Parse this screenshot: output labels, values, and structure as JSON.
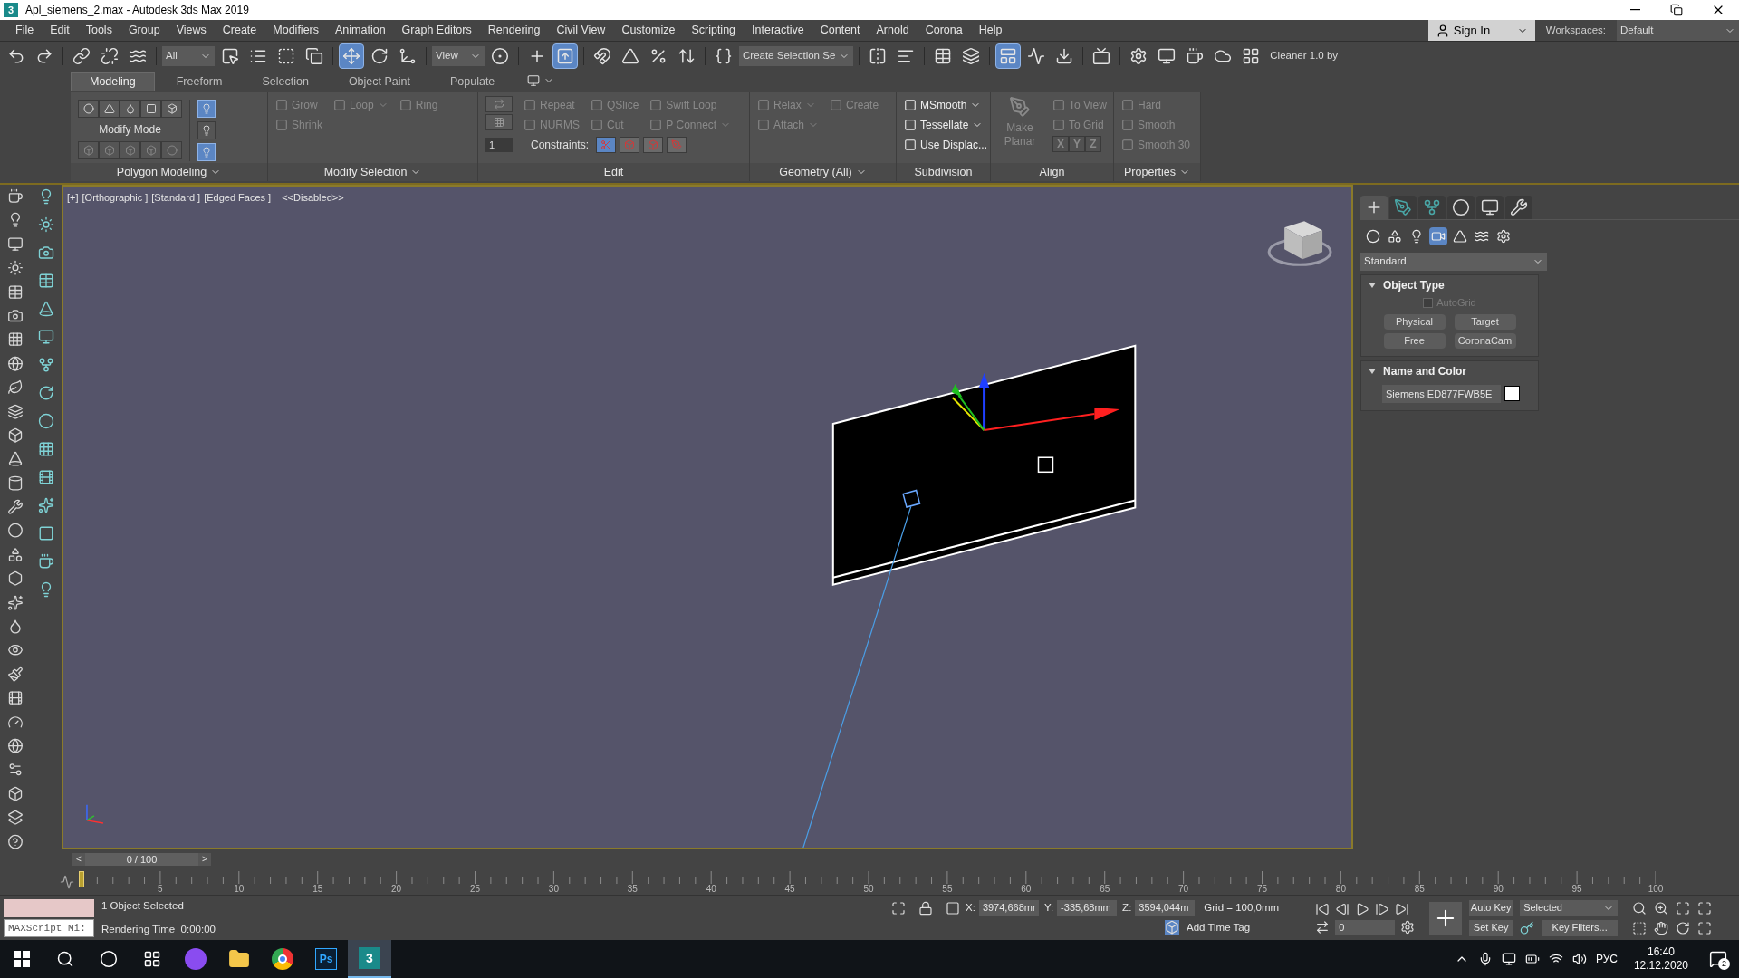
{
  "window": {
    "app_icon": "3",
    "title": "Apl_siemens_2.max - Autodesk 3ds Max 2019"
  },
  "menu": [
    "File",
    "Edit",
    "Tools",
    "Group",
    "Views",
    "Create",
    "Modifiers",
    "Animation",
    "Graph Editors",
    "Rendering",
    "Civil View",
    "Customize",
    "Scripting",
    "Interactive",
    "Content",
    "Arnold",
    "Corona",
    "Help"
  ],
  "account": {
    "sign_in": "Sign In",
    "workspaces_label": "Workspaces:",
    "workspace": "Default"
  },
  "main_toolbar": [
    {
      "kind": "icon",
      "selected": false
    },
    {
      "kind": "icon",
      "selected": false
    },
    {
      "kind": "separator"
    },
    {
      "kind": "icon",
      "selected": false
    },
    {
      "kind": "icon",
      "selected": false
    },
    {
      "kind": "icon",
      "selected": false
    },
    {
      "kind": "separator"
    },
    {
      "kind": "dropdown",
      "label": "All"
    },
    {
      "kind": "icon",
      "selected": false
    },
    {
      "kind": "icon",
      "selected": false
    },
    {
      "kind": "icon",
      "selected": false
    },
    {
      "kind": "icon",
      "selected": false
    },
    {
      "kind": "separator"
    },
    {
      "kind": "icon",
      "selected": true
    },
    {
      "kind": "icon",
      "selected": false
    },
    {
      "kind": "icon",
      "selected": false
    },
    {
      "kind": "separator"
    },
    {
      "kind": "dropdown",
      "label": "View"
    },
    {
      "kind": "icon",
      "selected": false
    },
    {
      "kind": "separator"
    },
    {
      "kind": "icon",
      "selected": false
    },
    {
      "kind": "icon",
      "selected": true
    },
    {
      "kind": "separator"
    },
    {
      "kind": "icon",
      "selected": false
    },
    {
      "kind": "icon",
      "selected": false
    },
    {
      "kind": "icon",
      "selected": false
    },
    {
      "kind": "icon",
      "selected": false
    },
    {
      "kind": "separator"
    },
    {
      "kind": "icon",
      "selected": false
    },
    {
      "kind": "dropdown",
      "label": "Create Selection Se"
    },
    {
      "kind": "separator"
    },
    {
      "kind": "icon",
      "selected": false
    },
    {
      "kind": "icon",
      "selected": false
    },
    {
      "kind": "separator"
    },
    {
      "kind": "icon",
      "selected": false
    },
    {
      "kind": "icon",
      "selected": false
    },
    {
      "kind": "separator"
    },
    {
      "kind": "icon",
      "selected": true
    },
    {
      "kind": "icon",
      "selected": false
    },
    {
      "kind": "icon",
      "selected": false
    },
    {
      "kind": "separator"
    },
    {
      "kind": "icon",
      "selected": false
    },
    {
      "kind": "separator"
    },
    {
      "kind": "icon",
      "selected": false
    },
    {
      "kind": "icon",
      "selected": false
    },
    {
      "kind": "icon",
      "selected": false
    },
    {
      "kind": "icon",
      "selected": false
    },
    {
      "kind": "icon",
      "selected": false
    },
    {
      "kind": "label",
      "label": "Cleaner 1.0 by"
    }
  ],
  "ribbon": {
    "tabs": [
      {
        "label": "Modeling",
        "selected": true
      },
      {
        "label": "Freeform",
        "selected": false
      },
      {
        "label": "Selection",
        "selected": false
      },
      {
        "label": "Object Paint",
        "selected": false
      },
      {
        "label": "Populate",
        "selected": false
      }
    ],
    "panels": [
      {
        "title": "Polygon Modeling",
        "dropdown": true,
        "kind": "modify_mode",
        "label": "Modify Mode",
        "toggles": [
          {
            "selected": true
          },
          {
            "selected": false
          },
          {
            "selected": true
          }
        ]
      },
      {
        "title": "Modify Selection",
        "dropdown": true,
        "kind": "tools",
        "columns": [
          [
            {
              "kind": "tool",
              "label": "Grow",
              "disabled": true,
              "dropdown": false
            },
            {
              "kind": "tool",
              "label": "Shrink",
              "disabled": true,
              "dropdown": false
            }
          ],
          [
            {
              "kind": "tool",
              "label": "Loop",
              "disabled": true,
              "dropdown": true
            }
          ],
          [
            {
              "kind": "tool",
              "label": "Ring",
              "disabled": true,
              "dropdown": false
            }
          ]
        ]
      },
      {
        "title": "Edit",
        "dropdown": false,
        "kind": "edit",
        "spinner": "1",
        "constraints": "Constraints:",
        "columns": [
          [
            {
              "kind": "tool",
              "label": "Repeat",
              "disabled": true,
              "dropdown": false
            },
            {
              "kind": "tool",
              "label": "NURMS",
              "disabled": true,
              "dropdown": false
            }
          ],
          [
            {
              "kind": "tool",
              "label": "QSlice",
              "disabled": true,
              "dropdown": false
            },
            {
              "kind": "tool",
              "label": "Cut",
              "disabled": true,
              "dropdown": false
            }
          ],
          [
            {
              "kind": "tool",
              "label": "Swift Loop",
              "disabled": true,
              "dropdown": false
            },
            {
              "kind": "tool",
              "label": "P Connect",
              "disabled": true,
              "dropdown": true
            }
          ]
        ]
      },
      {
        "title": "Geometry (All)",
        "dropdown": true,
        "kind": "tools",
        "columns": [
          [
            {
              "kind": "tool",
              "label": "Relax",
              "disabled": true,
              "dropdown": true
            },
            {
              "kind": "tool",
              "label": "Attach",
              "disabled": true,
              "dropdown": true
            }
          ],
          [
            {
              "kind": "tool",
              "label": "Create",
              "disabled": true,
              "dropdown": false
            }
          ]
        ]
      },
      {
        "title": "Subdivision",
        "dropdown": false,
        "kind": "tools",
        "columns": [
          [
            {
              "kind": "tool",
              "label": "MSmooth",
              "disabled": false,
              "dropdown": true
            },
            {
              "kind": "tool",
              "label": "Tessellate",
              "disabled": false,
              "dropdown": true
            },
            {
              "kind": "tool",
              "label": "Use Displac...",
              "disabled": false,
              "dropdown": false
            }
          ]
        ]
      },
      {
        "title": "Align",
        "dropdown": false,
        "kind": "tools",
        "columns": [
          [
            {
              "kind": "big",
              "label": "Make Planar",
              "disabled": true
            }
          ],
          [
            {
              "kind": "tool",
              "label": "To View",
              "disabled": true,
              "dropdown": false
            },
            {
              "kind": "tool",
              "label": "To Grid",
              "disabled": true,
              "dropdown": false
            },
            {
              "kind": "axes",
              "labels": [
                "X",
                "Y",
                "Z"
              ],
              "disabled": true
            }
          ]
        ]
      },
      {
        "title": "Properties",
        "dropdown": true,
        "kind": "tools",
        "columns": [
          [
            {
              "kind": "tool",
              "label": "Hard",
              "disabled": true,
              "dropdown": false
            },
            {
              "kind": "tool",
              "label": "Smooth",
              "disabled": true,
              "dropdown": false
            },
            {
              "kind": "tool",
              "label": "Smooth 30",
              "disabled": true,
              "dropdown": false
            }
          ]
        ]
      }
    ]
  },
  "viewport": {
    "labels": [
      "[+]",
      "[Orthographic ]",
      "[Standard ]",
      "[Edged Faces ]",
      "<<Disabled>>"
    ]
  },
  "command_panel": {
    "tabs": [
      {
        "selected": true
      },
      {
        "selected": false
      },
      {
        "selected": false
      },
      {
        "selected": false
      },
      {
        "selected": false
      },
      {
        "selected": false
      }
    ],
    "categories": [
      {
        "selected": false
      },
      {
        "selected": false
      },
      {
        "selected": false
      },
      {
        "selected": true
      },
      {
        "selected": false
      },
      {
        "selected": false
      },
      {
        "selected": false
      }
    ],
    "dropdown": "Standard",
    "rollouts": [
      {
        "kind": "object_type",
        "title": "Object Type",
        "expanded": true,
        "autogrid": {
          "label": "AutoGrid",
          "checked": false,
          "disabled": true
        },
        "buttons": [
          "Physical",
          "Target",
          "Free",
          "CoronaCam"
        ]
      },
      {
        "kind": "name_color",
        "title": "Name and Color",
        "expanded": true,
        "name": "Siemens ED877FWB5E",
        "color": "#ffffff"
      }
    ]
  },
  "timeline": {
    "slider": "0 / 100",
    "prev": "<",
    "next": ">",
    "ruler_labels": [
      "5",
      "10",
      "15",
      "20",
      "25",
      "30",
      "35",
      "40",
      "45",
      "50",
      "55",
      "60",
      "65",
      "70",
      "75",
      "80",
      "85",
      "90",
      "95",
      "100"
    ]
  },
  "status": {
    "maxscript": "MAXScript Mi:",
    "selection": "1 Object Selected",
    "render_time": "Rendering Time  0:00:00",
    "coords": [
      {
        "axis": "X:",
        "value": "3974,668mr"
      },
      {
        "axis": "Y:",
        "value": "-335,68mm"
      },
      {
        "axis": "Z:",
        "value": "3594,044m"
      }
    ],
    "grid": "Grid = 100,0mm",
    "time_tag": "Add Time Tag",
    "auto_key": "Auto Key",
    "set_key": "Set Key",
    "key_mode": "Selected",
    "key_filters": "Key Filters...",
    "frame": "0"
  },
  "taskbar": {
    "apps": [
      {
        "kind": "assistant",
        "selected": false
      },
      {
        "kind": "folder",
        "selected": false
      },
      {
        "kind": "browser",
        "selected": false
      },
      {
        "kind": "ps",
        "label": "Ps",
        "selected": false
      },
      {
        "kind": "max",
        "label": "3",
        "selected": true
      }
    ],
    "language": "РУС",
    "time": "16:40",
    "date": "12.12.2020",
    "notifications": "2"
  }
}
